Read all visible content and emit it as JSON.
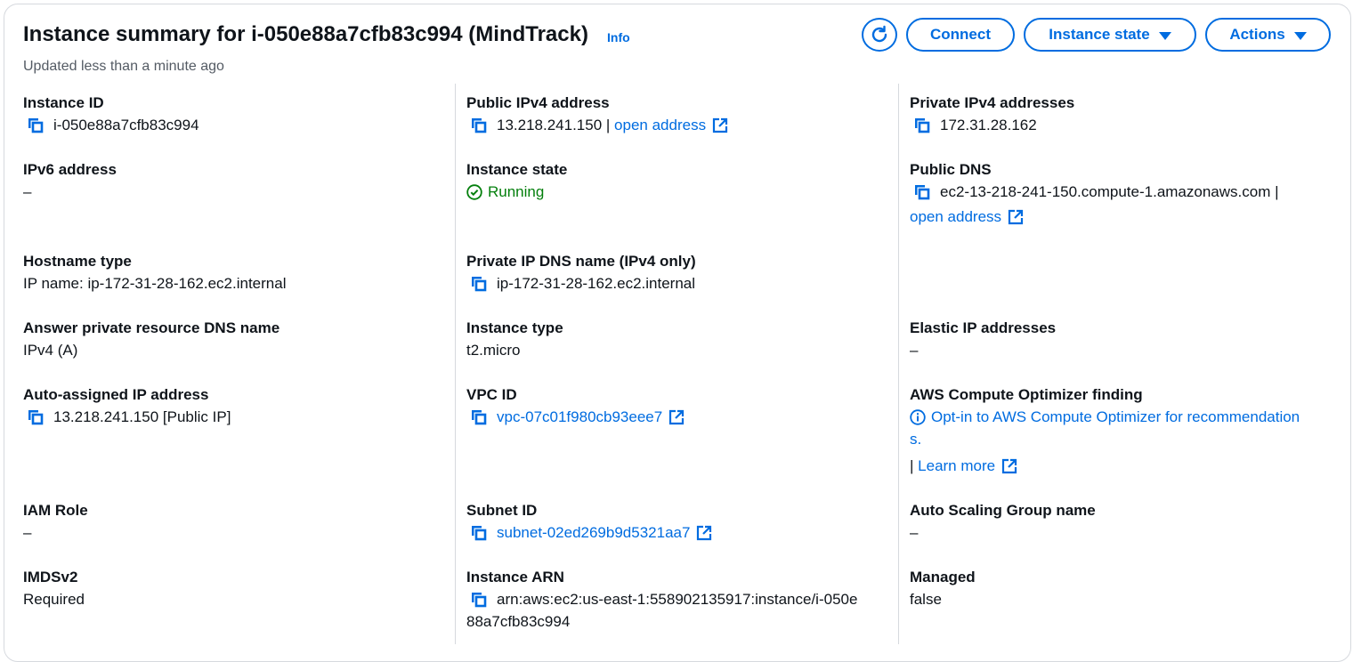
{
  "header": {
    "title": "Instance summary for i-050e88a7cfb83c994 (MindTrack)",
    "info": "Info",
    "updated": "Updated less than a minute ago",
    "buttons": {
      "connect": "Connect",
      "instance_state": "Instance state",
      "actions": "Actions"
    }
  },
  "col1": {
    "instance_id": {
      "label": "Instance ID",
      "value": "i-050e88a7cfb83c994"
    },
    "ipv6": {
      "label": "IPv6 address",
      "value": "–"
    },
    "hostname_type": {
      "label": "Hostname type",
      "value": "IP name: ip-172-31-28-162.ec2.internal"
    },
    "answer_dns": {
      "label": "Answer private resource DNS name",
      "value": "IPv4 (A)"
    },
    "auto_ip": {
      "label": "Auto-assigned IP address",
      "value": "13.218.241.150 [Public IP]"
    },
    "iam_role": {
      "label": "IAM Role",
      "value": "–"
    },
    "imdsv2": {
      "label": "IMDSv2",
      "value": "Required"
    }
  },
  "col2": {
    "public_ipv4": {
      "label": "Public IPv4 address",
      "value": "13.218.241.150 |",
      "link": "open address"
    },
    "instance_state": {
      "label": "Instance state",
      "value": "Running"
    },
    "private_dns": {
      "label": "Private IP DNS name (IPv4 only)",
      "value": "ip-172-31-28-162.ec2.internal"
    },
    "instance_type": {
      "label": "Instance type",
      "value": "t2.micro"
    },
    "vpc_id": {
      "label": "VPC ID",
      "value": "vpc-07c01f980cb93eee7"
    },
    "subnet_id": {
      "label": "Subnet ID",
      "value": "subnet-02ed269b9d5321aa7"
    },
    "instance_arn": {
      "label": "Instance ARN",
      "value_line1": "arn:aws:ec2:us-east-1:558902135917:instance/i-050e",
      "value_line2": "88a7cfb83c994"
    }
  },
  "col3": {
    "private_ipv4": {
      "label": "Private IPv4 addresses",
      "value": "172.31.28.162"
    },
    "public_dns": {
      "label": "Public DNS",
      "value": "ec2-13-218-241-150.compute-1.amazonaws.com |",
      "link": "open address"
    },
    "elastic_ip": {
      "label": "Elastic IP addresses",
      "value": "–"
    },
    "optimizer": {
      "label": "AWS Compute Optimizer finding",
      "line1": "Opt-in to AWS Compute Optimizer for recommendation",
      "line2": "s.",
      "sep": "|",
      "learn_more": "Learn more"
    },
    "asg": {
      "label": "Auto Scaling Group name",
      "value": "–"
    },
    "managed": {
      "label": "Managed",
      "value": "false"
    }
  },
  "colors": {
    "link": "#006ce0",
    "success": "#037f0c",
    "text": "#0f141a",
    "muted": "#545b64"
  },
  "icons": [
    "refresh-icon",
    "caret-down-icon",
    "copy-icon",
    "external-link-icon",
    "check-circle-icon",
    "info-circle-icon"
  ]
}
